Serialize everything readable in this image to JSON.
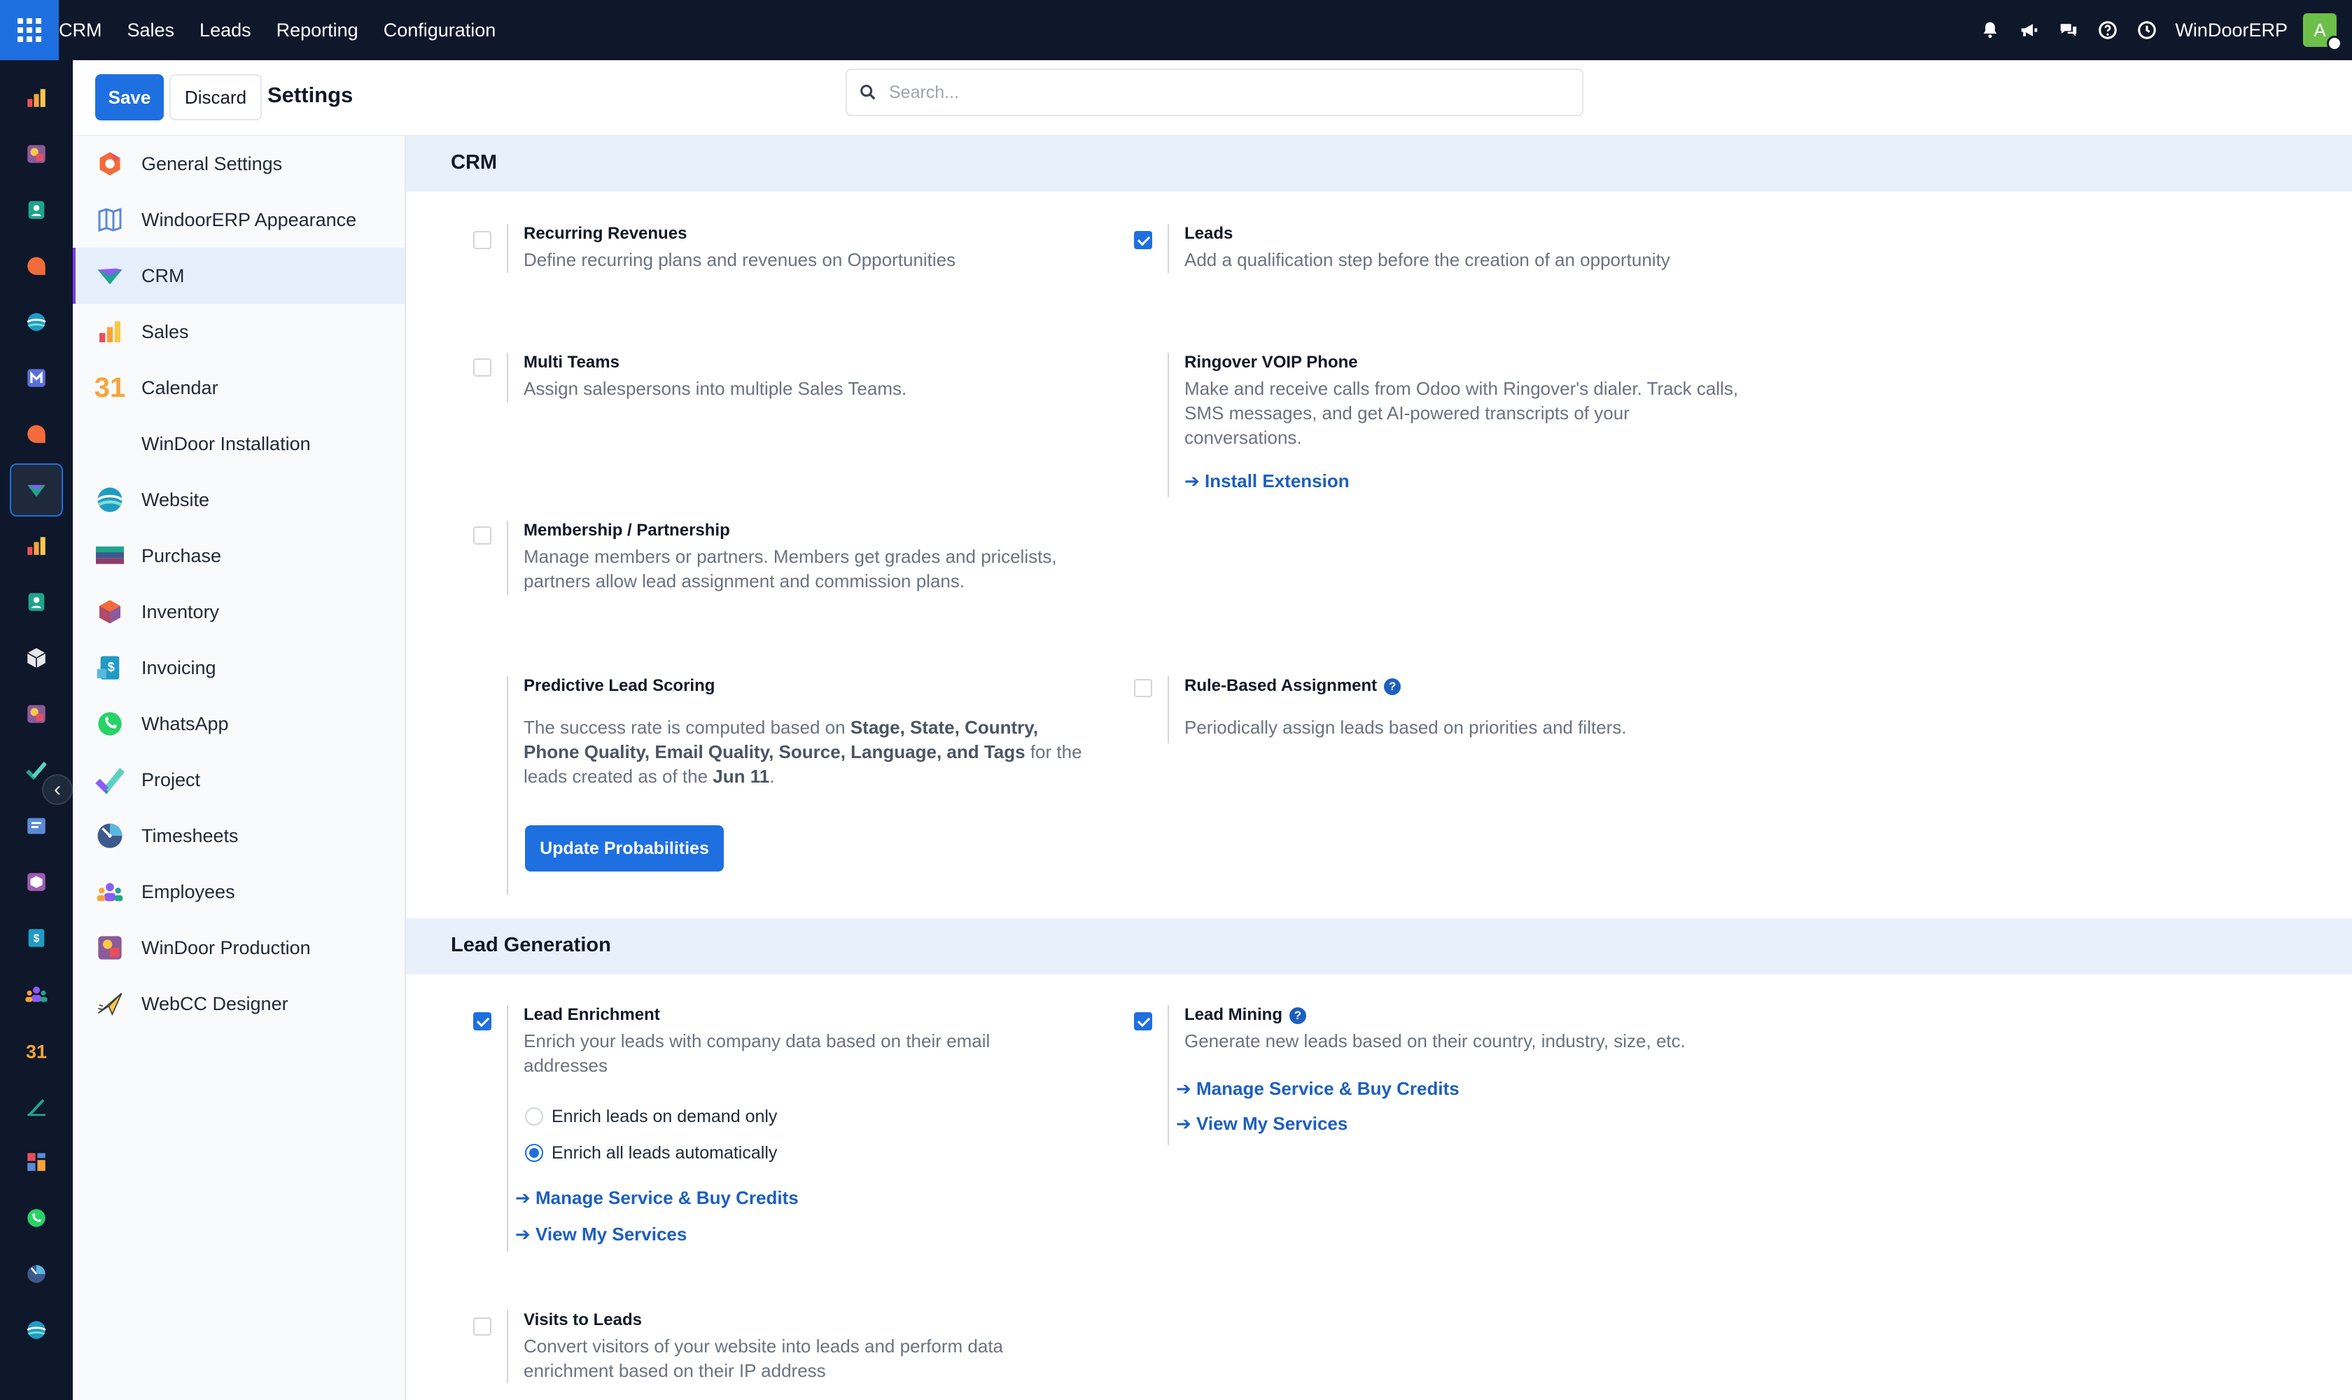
{
  "topbar": {
    "menu": [
      "CRM",
      "Sales",
      "Leads",
      "Reporting",
      "Configuration"
    ],
    "company": "WinDoorERP",
    "avatar_letter": "A",
    "icons": [
      "bell-icon",
      "megaphone-icon",
      "chat-icon",
      "help-icon",
      "clock-icon"
    ]
  },
  "control": {
    "save_label": "Save",
    "discard_label": "Discard",
    "title": "Settings",
    "search_placeholder": "Search..."
  },
  "sidebar": {
    "items": [
      {
        "label": "General Settings",
        "icon": "general-settings-icon"
      },
      {
        "label": "WindoorERP Appearance",
        "icon": "appearance-icon"
      },
      {
        "label": "CRM",
        "icon": "crm-icon",
        "active": true
      },
      {
        "label": "Sales",
        "icon": "sales-icon"
      },
      {
        "label": "Calendar",
        "icon": "calendar-icon"
      },
      {
        "label": "WinDoor Installation",
        "icon": ""
      },
      {
        "label": "Website",
        "icon": "website-icon"
      },
      {
        "label": "Purchase",
        "icon": "purchase-icon"
      },
      {
        "label": "Inventory",
        "icon": "inventory-icon"
      },
      {
        "label": "Invoicing",
        "icon": "invoicing-icon"
      },
      {
        "label": "WhatsApp",
        "icon": "whatsapp-icon"
      },
      {
        "label": "Project",
        "icon": "project-icon"
      },
      {
        "label": "Timesheets",
        "icon": "timesheets-icon"
      },
      {
        "label": "Employees",
        "icon": "employees-icon"
      },
      {
        "label": "WinDoor Production",
        "icon": "production-icon"
      },
      {
        "label": "WebCC Designer",
        "icon": "designer-icon"
      }
    ]
  },
  "calendar_glyph": "31",
  "sections": {
    "crm": {
      "title": "CRM",
      "recurring": {
        "title": "Recurring Revenues",
        "desc": "Define recurring plans and revenues on Opportunities",
        "checked": false
      },
      "leads": {
        "title": "Leads",
        "desc": "Add a qualification step before the creation of an opportunity",
        "checked": true
      },
      "multi_teams": {
        "title": "Multi Teams",
        "desc": "Assign salespersons into multiple Sales Teams.",
        "checked": false
      },
      "ringover": {
        "title": "Ringover VOIP Phone",
        "desc": "Make and receive calls from Odoo with Ringover's dialer. Track calls, SMS messages, and get AI-powered transcripts of your conversations.",
        "link": "Install Extension"
      },
      "membership": {
        "title": "Membership / Partnership",
        "desc": "Manage members or partners. Members get grades and pricelists, partners allow lead assignment and commission plans.",
        "checked": false
      },
      "scoring": {
        "title": "Predictive Lead Scoring",
        "desc_1": "The success rate is computed based on ",
        "desc_bold": "Stage, State, Country, Phone Quality, Email Quality, Source, Language, and Tags",
        "desc_2": " for the leads created as of the ",
        "desc_date": "Jun 11",
        "desc_3": ".",
        "button": "Update Probabilities"
      },
      "rule_based": {
        "title": "Rule-Based Assignment",
        "help": "?",
        "desc": "Periodically assign leads based on priorities and filters.",
        "checked": false
      }
    },
    "lead_gen": {
      "title": "Lead Generation",
      "enrichment": {
        "title": "Lead Enrichment",
        "desc": "Enrich your leads with company data based on their email addresses",
        "checked": true,
        "options": [
          {
            "label": "Enrich leads on demand only",
            "selected": false
          },
          {
            "label": "Enrich all leads automatically",
            "selected": true
          }
        ],
        "link_manage": "Manage Service & Buy Credits",
        "link_view": "View My Services"
      },
      "mining": {
        "title": "Lead Mining",
        "help": "?",
        "desc": "Generate new leads based on their country, industry, size, etc.",
        "checked": true,
        "link_manage": "Manage Service & Buy Credits",
        "link_view": "View My Services"
      },
      "visits": {
        "title": "Visits to Leads",
        "desc": "Convert visitors of your website into leads and perform data enrichment based on their IP address",
        "checked": false
      }
    }
  },
  "colors": {
    "accent": "#1e6fe0",
    "topbar": "#0f172a",
    "section_bg": "#e8f0fb",
    "link": "#1d5fbf"
  }
}
